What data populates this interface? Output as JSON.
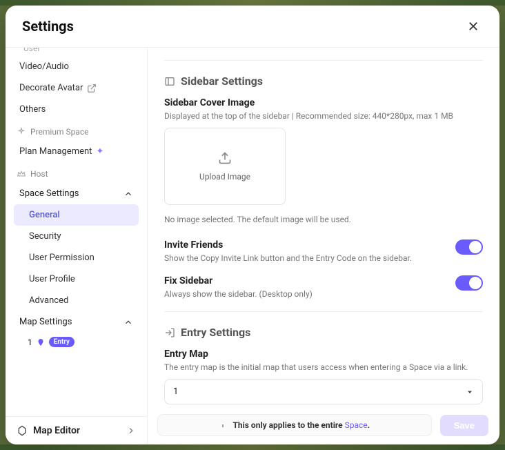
{
  "header": {
    "title": "Settings"
  },
  "sidebar": {
    "cut_item": "User",
    "items": {
      "video_audio": "Video/Audio",
      "decorate_avatar": "Decorate Avatar",
      "others": "Others"
    },
    "premium": {
      "header": "Premium Space",
      "plan_management": "Plan Management"
    },
    "host": {
      "header": "Host",
      "space_settings": "Space Settings",
      "general": "General",
      "security": "Security",
      "user_permission": "User Permission",
      "user_profile": "User Profile",
      "advanced": "Advanced",
      "map_settings": "Map Settings",
      "map_row_num": "1",
      "entry": "Entry"
    },
    "footer": {
      "label": "Map Editor"
    }
  },
  "content": {
    "sidebar_settings": {
      "title": "Sidebar Settings",
      "cover_title": "Sidebar Cover Image",
      "cover_desc": "Displayed at the top of the sidebar | Recommended size: 440*280px, max 1 MB",
      "upload_label": "Upload Image",
      "no_image": "No image selected. The default image will be used.",
      "invite_title": "Invite Friends",
      "invite_desc": "Show the Copy Invite Link button and the Entry Code on the sidebar.",
      "fix_title": "Fix Sidebar",
      "fix_desc": "Always show the sidebar. (Desktop only)"
    },
    "entry_settings": {
      "title": "Entry Settings",
      "map_title": "Entry Map",
      "map_desc": "The entry map is the initial map that users access when entering a Space via a link.",
      "map_value": "1"
    }
  },
  "footer_bar": {
    "note_prefix": "This only applies to the entire ",
    "note_link": "Space",
    "note_suffix": ".",
    "save": "Save"
  }
}
